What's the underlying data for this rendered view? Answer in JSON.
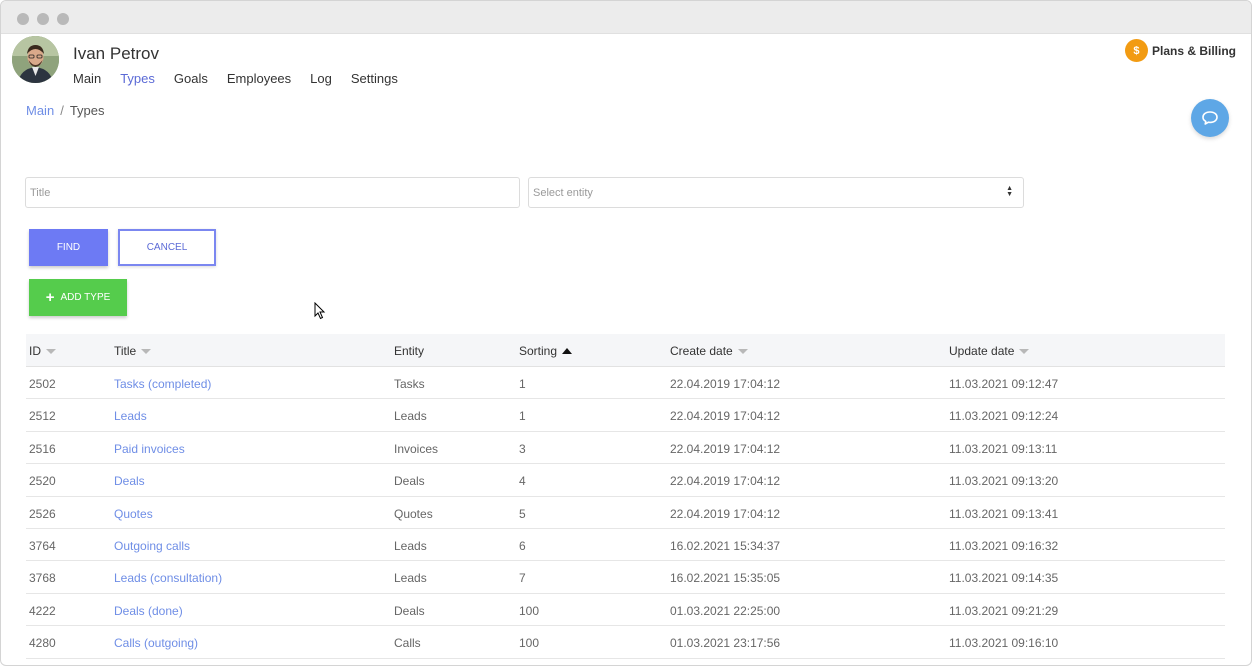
{
  "user": {
    "name": "Ivan Petrov"
  },
  "nav": [
    {
      "label": "Main",
      "active": false
    },
    {
      "label": "Types",
      "active": true
    },
    {
      "label": "Goals",
      "active": false
    },
    {
      "label": "Employees",
      "active": false
    },
    {
      "label": "Log",
      "active": false
    },
    {
      "label": "Settings",
      "active": false
    }
  ],
  "billing": {
    "coin": "$",
    "label": "Plans & Billing"
  },
  "breadcrumb": {
    "parent": "Main",
    "separator": "/",
    "current": "Types"
  },
  "filters": {
    "title_placeholder": "Title",
    "entity_placeholder": "Select entity"
  },
  "buttons": {
    "find": "FIND",
    "cancel": "CANCEL",
    "add_type": "ADD TYPE"
  },
  "table": {
    "columns": [
      {
        "label": "ID",
        "sort": "none"
      },
      {
        "label": "Title",
        "sort": "none"
      },
      {
        "label": "Entity",
        "sort": null
      },
      {
        "label": "Sorting",
        "sort": "asc"
      },
      {
        "label": "Create date",
        "sort": "none"
      },
      {
        "label": "Update date",
        "sort": "none"
      }
    ],
    "rows": [
      [
        "2502",
        "Tasks (completed)",
        "Tasks",
        "1",
        "22.04.2019 17:04:12",
        "11.03.2021 09:12:47"
      ],
      [
        "2512",
        "Leads",
        "Leads",
        "1",
        "22.04.2019 17:04:12",
        "11.03.2021 09:12:24"
      ],
      [
        "2516",
        "Paid invoices",
        "Invoices",
        "3",
        "22.04.2019 17:04:12",
        "11.03.2021 09:13:11"
      ],
      [
        "2520",
        "Deals",
        "Deals",
        "4",
        "22.04.2019 17:04:12",
        "11.03.2021 09:13:20"
      ],
      [
        "2526",
        "Quotes",
        "Quotes",
        "5",
        "22.04.2019 17:04:12",
        "11.03.2021 09:13:41"
      ],
      [
        "3764",
        "Outgoing calls",
        "Leads",
        "6",
        "16.02.2021 15:34:37",
        "11.03.2021 09:16:32"
      ],
      [
        "3768",
        "Leads (consultation)",
        "Leads",
        "7",
        "16.02.2021 15:35:05",
        "11.03.2021 09:14:35"
      ],
      [
        "4222",
        "Deals (done)",
        "Deals",
        "100",
        "01.03.2021 22:25:00",
        "11.03.2021 09:21:29"
      ],
      [
        "4280",
        "Calls (outgoing)",
        "Calls",
        "100",
        "01.03.2021 23:17:56",
        "11.03.2021 09:16:10"
      ]
    ]
  },
  "colors": {
    "accent": "#6d7af4",
    "link": "#6f8ee6",
    "success": "#55cc4c",
    "coin": "#f29b12",
    "chat": "#5ea7e6"
  }
}
